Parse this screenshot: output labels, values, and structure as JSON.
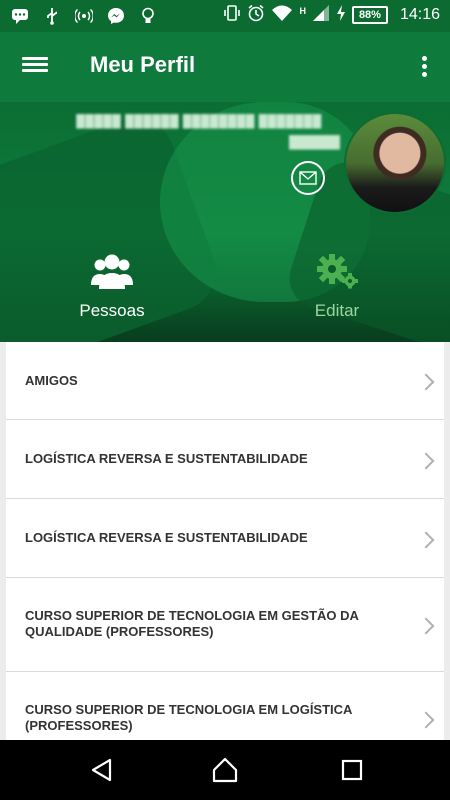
{
  "status_bar": {
    "icons": [
      "chat-icon",
      "usb-icon",
      "hotspot-icon",
      "messenger-icon",
      "bulb-icon"
    ],
    "right_icons": [
      "vibrate-icon",
      "alarm-icon",
      "wifi-icon",
      "signal-icon",
      "charging-icon"
    ],
    "network_label": "H",
    "battery": "88%",
    "time": "14:16"
  },
  "app_bar": {
    "title": "Meu Perfil"
  },
  "profile": {
    "tabs": [
      {
        "label": "Pessoas",
        "icon": "people-icon"
      },
      {
        "label": "Editar",
        "icon": "gear-icon"
      }
    ]
  },
  "list": {
    "items": [
      {
        "label": "AMIGOS"
      },
      {
        "label": "LOGÍSTICA REVERSA E SUSTENTABILIDADE"
      },
      {
        "label": "LOGÍSTICA REVERSA E SUSTENTABILIDADE"
      },
      {
        "label": "CURSO SUPERIOR DE TECNOLOGIA EM GESTÃO DA QUALIDADE (PROFESSORES)"
      },
      {
        "label": "CURSO SUPERIOR DE TECNOLOGIA EM LOGÍSTICA (PROFESSORES)"
      }
    ]
  },
  "colors": {
    "primary": "#0e7a3c",
    "status_bar": "#0b6b30"
  }
}
